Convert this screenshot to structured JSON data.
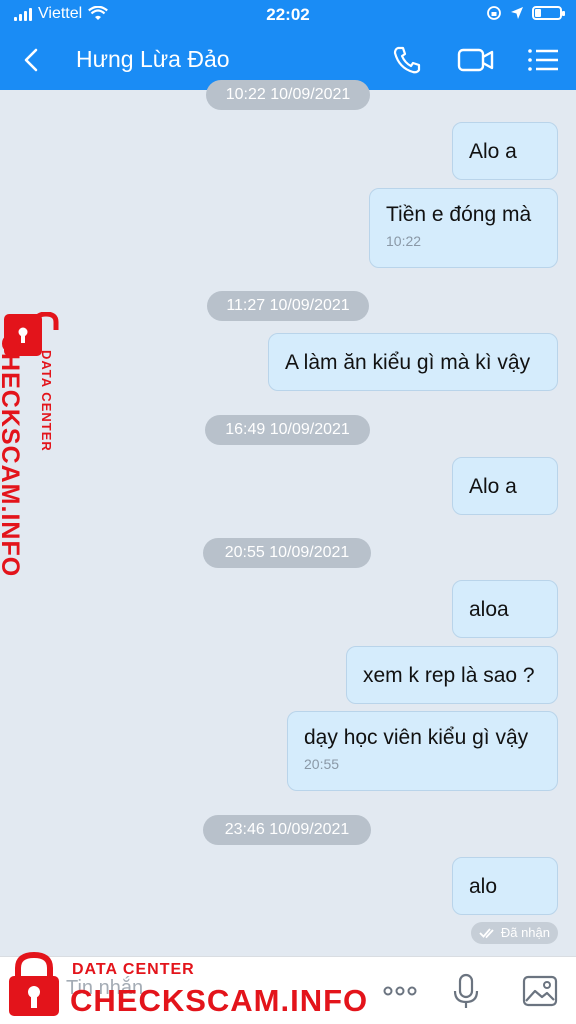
{
  "status_bar": {
    "carrier": "Viettel",
    "time": "22:02"
  },
  "header": {
    "contact_name": "Hưng Lừa Đảo",
    "icons": [
      "back-arrow-icon",
      "phone-icon",
      "video-call-icon",
      "menu-list-icon"
    ]
  },
  "messages": [
    {
      "type": "time",
      "text": "10:22 10/09/2021"
    },
    {
      "type": "sent",
      "text": "Alo a"
    },
    {
      "type": "sent",
      "text": "Tiền e đóng mà",
      "time": "10:22"
    },
    {
      "type": "time",
      "text": "11:27 10/09/2021"
    },
    {
      "type": "sent",
      "text": "A làm ăn kiểu gì mà kì vậy"
    },
    {
      "type": "time",
      "text": "16:49 10/09/2021"
    },
    {
      "type": "sent",
      "text": "Alo a"
    },
    {
      "type": "time",
      "text": "20:55 10/09/2021"
    },
    {
      "type": "sent",
      "text": "aloa"
    },
    {
      "type": "sent",
      "text": "xem k rep là sao ?"
    },
    {
      "type": "sent",
      "text": "dạy học viên kiểu gì vậy",
      "time": "20:55"
    },
    {
      "type": "time",
      "text": "23:46 10/09/2021"
    },
    {
      "type": "sent",
      "text": "alo"
    }
  ],
  "delivery_status": "Đã nhận",
  "composer": {
    "placeholder": "Tin nhắn",
    "icons": [
      "more-icon",
      "microphone-icon",
      "image-icon"
    ]
  },
  "watermark": {
    "small_text": "DATA CENTER",
    "brand_text": "CHECKSCAM.INFO",
    "color": "#e3141b"
  },
  "colors": {
    "header": "#1a8cf5",
    "chat_bg": "#e2e9f1",
    "bubble": "#d5ecfc"
  }
}
